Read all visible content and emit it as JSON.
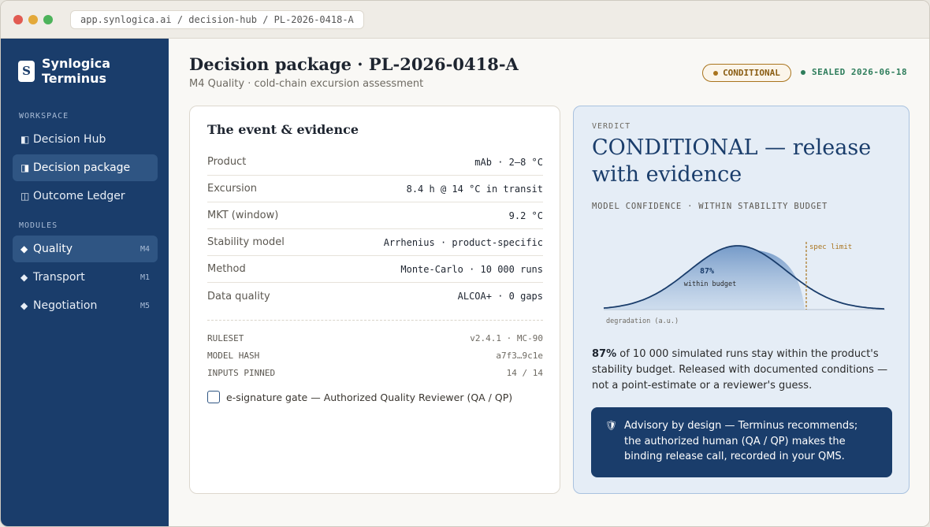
{
  "browser": {
    "url": "app.synlogica.ai / decision-hub / PL-2026-0418-A"
  },
  "brand": {
    "mark": "S",
    "name": "Synlogica Terminus"
  },
  "sidebar": {
    "workspace_label": "WORKSPACE",
    "workspace_items": [
      {
        "icon": "◧",
        "label": "Decision Hub",
        "active": false
      },
      {
        "icon": "◨",
        "label": "Decision package",
        "active": true
      },
      {
        "icon": "◫",
        "label": "Outcome Ledger",
        "active": false
      }
    ],
    "modules_label": "MODULES",
    "module_items": [
      {
        "icon": "◆",
        "label": "Quality",
        "tag": "M4",
        "active": true
      },
      {
        "icon": "◆",
        "label": "Transport",
        "tag": "M1",
        "active": false
      },
      {
        "icon": "◆",
        "label": "Negotiation",
        "tag": "M5",
        "active": false
      }
    ]
  },
  "header": {
    "title": "Decision package · PL-2026-0418-A",
    "subtitle": "M4 Quality · cold-chain excursion assessment",
    "status_badge": "CONDITIONAL",
    "sealed_badge": "SEALED 2026-06-18"
  },
  "evidence": {
    "title": "The event & evidence",
    "rows": [
      {
        "key": "Product",
        "value": "mAb · 2–8 °C"
      },
      {
        "key": "Excursion",
        "value": "8.4 h @ 14 °C in transit"
      },
      {
        "key": "MKT (window)",
        "value": "9.2 °C"
      },
      {
        "key": "Stability model",
        "value": "Arrhenius · product-specific"
      },
      {
        "key": "Method",
        "value": "Monte-Carlo · 10 000 runs"
      },
      {
        "key": "Data quality",
        "value": "ALCOA+ · 0 gaps"
      }
    ],
    "meta": [
      {
        "key": "RULESET",
        "value": "v2.4.1 · MC-90"
      },
      {
        "key": "MODEL HASH",
        "value": "a7f3…9c1e"
      },
      {
        "key": "INPUTS PINNED",
        "value": "14 / 14"
      }
    ],
    "esignature_label": "e-signature gate — Authorized Quality Reviewer (QA / QP)"
  },
  "verdict": {
    "label": "VERDICT",
    "headline": "CONDITIONAL — release with evidence",
    "confidence_label": "MODEL CONFIDENCE · WITHIN STABILITY BUDGET",
    "text_strong": "87%",
    "text_rest": " of 10 000 simulated runs stay within the product's stability budget. Released with documented conditions — not a point-estimate or a reviewer's guess.",
    "advisory": "Advisory by design — Terminus recommends; the authorized human (QA / QP) makes the binding release call, recorded in your QMS.",
    "advisory_icon": "shield-icon"
  },
  "chart_data": {
    "type": "area",
    "within_budget_pct": 87,
    "value_label": "87%",
    "value_sublabel": "within budget",
    "limit_label": "spec limit",
    "xlabel": "degradation (a.u.)"
  },
  "colors": {
    "sidebar": "#1a3d6b",
    "accent_blue": "#1a3d6b",
    "conditional": "#a9741d",
    "sealed": "#2e7d5b",
    "chart_fill": "#6f96c6"
  }
}
